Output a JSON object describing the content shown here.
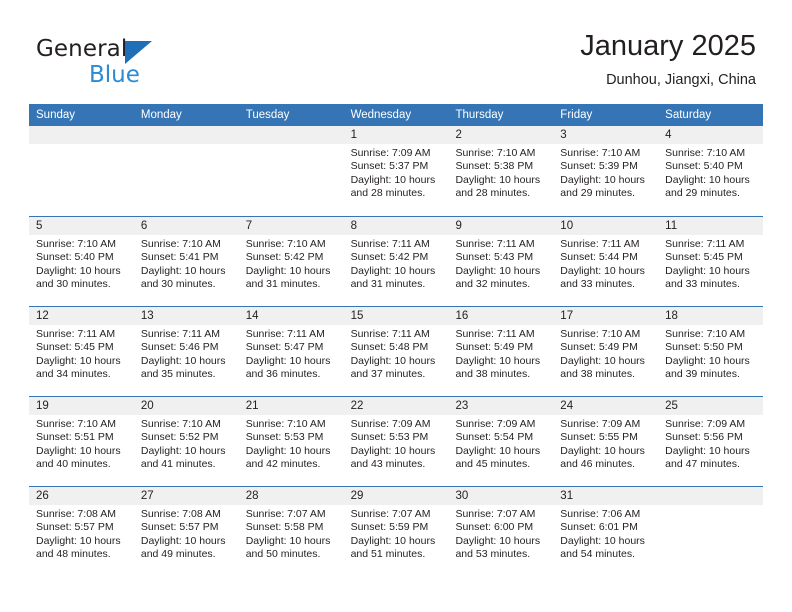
{
  "brand": {
    "name_part1": "General",
    "name_part2": "Blue",
    "triangle_color": "#1e6fb8",
    "blue_color": "#2b8bd4"
  },
  "header": {
    "title": "January 2025",
    "subtitle": "Dunhou, Jiangxi, China"
  },
  "colors": {
    "header_band": "#3575b5",
    "day_number_band": "#f0f0f0",
    "text": "#231f20"
  },
  "weekdays": [
    "Sunday",
    "Monday",
    "Tuesday",
    "Wednesday",
    "Thursday",
    "Friday",
    "Saturday"
  ],
  "labels": {
    "sunrise": "Sunrise:",
    "sunset": "Sunset:",
    "daylight": "Daylight:"
  },
  "weeks": [
    [
      {
        "day": "",
        "empty": true
      },
      {
        "day": "",
        "empty": true
      },
      {
        "day": "",
        "empty": true
      },
      {
        "day": "1",
        "sunrise": "Sunrise: 7:09 AM",
        "sunset": "Sunset: 5:37 PM",
        "daylight_l1": "Daylight: 10 hours",
        "daylight_l2": "and 28 minutes."
      },
      {
        "day": "2",
        "sunrise": "Sunrise: 7:10 AM",
        "sunset": "Sunset: 5:38 PM",
        "daylight_l1": "Daylight: 10 hours",
        "daylight_l2": "and 28 minutes."
      },
      {
        "day": "3",
        "sunrise": "Sunrise: 7:10 AM",
        "sunset": "Sunset: 5:39 PM",
        "daylight_l1": "Daylight: 10 hours",
        "daylight_l2": "and 29 minutes."
      },
      {
        "day": "4",
        "sunrise": "Sunrise: 7:10 AM",
        "sunset": "Sunset: 5:40 PM",
        "daylight_l1": "Daylight: 10 hours",
        "daylight_l2": "and 29 minutes."
      }
    ],
    [
      {
        "day": "5",
        "sunrise": "Sunrise: 7:10 AM",
        "sunset": "Sunset: 5:40 PM",
        "daylight_l1": "Daylight: 10 hours",
        "daylight_l2": "and 30 minutes."
      },
      {
        "day": "6",
        "sunrise": "Sunrise: 7:10 AM",
        "sunset": "Sunset: 5:41 PM",
        "daylight_l1": "Daylight: 10 hours",
        "daylight_l2": "and 30 minutes."
      },
      {
        "day": "7",
        "sunrise": "Sunrise: 7:10 AM",
        "sunset": "Sunset: 5:42 PM",
        "daylight_l1": "Daylight: 10 hours",
        "daylight_l2": "and 31 minutes."
      },
      {
        "day": "8",
        "sunrise": "Sunrise: 7:11 AM",
        "sunset": "Sunset: 5:42 PM",
        "daylight_l1": "Daylight: 10 hours",
        "daylight_l2": "and 31 minutes."
      },
      {
        "day": "9",
        "sunrise": "Sunrise: 7:11 AM",
        "sunset": "Sunset: 5:43 PM",
        "daylight_l1": "Daylight: 10 hours",
        "daylight_l2": "and 32 minutes."
      },
      {
        "day": "10",
        "sunrise": "Sunrise: 7:11 AM",
        "sunset": "Sunset: 5:44 PM",
        "daylight_l1": "Daylight: 10 hours",
        "daylight_l2": "and 33 minutes."
      },
      {
        "day": "11",
        "sunrise": "Sunrise: 7:11 AM",
        "sunset": "Sunset: 5:45 PM",
        "daylight_l1": "Daylight: 10 hours",
        "daylight_l2": "and 33 minutes."
      }
    ],
    [
      {
        "day": "12",
        "sunrise": "Sunrise: 7:11 AM",
        "sunset": "Sunset: 5:45 PM",
        "daylight_l1": "Daylight: 10 hours",
        "daylight_l2": "and 34 minutes."
      },
      {
        "day": "13",
        "sunrise": "Sunrise: 7:11 AM",
        "sunset": "Sunset: 5:46 PM",
        "daylight_l1": "Daylight: 10 hours",
        "daylight_l2": "and 35 minutes."
      },
      {
        "day": "14",
        "sunrise": "Sunrise: 7:11 AM",
        "sunset": "Sunset: 5:47 PM",
        "daylight_l1": "Daylight: 10 hours",
        "daylight_l2": "and 36 minutes."
      },
      {
        "day": "15",
        "sunrise": "Sunrise: 7:11 AM",
        "sunset": "Sunset: 5:48 PM",
        "daylight_l1": "Daylight: 10 hours",
        "daylight_l2": "and 37 minutes."
      },
      {
        "day": "16",
        "sunrise": "Sunrise: 7:11 AM",
        "sunset": "Sunset: 5:49 PM",
        "daylight_l1": "Daylight: 10 hours",
        "daylight_l2": "and 38 minutes."
      },
      {
        "day": "17",
        "sunrise": "Sunrise: 7:10 AM",
        "sunset": "Sunset: 5:49 PM",
        "daylight_l1": "Daylight: 10 hours",
        "daylight_l2": "and 38 minutes."
      },
      {
        "day": "18",
        "sunrise": "Sunrise: 7:10 AM",
        "sunset": "Sunset: 5:50 PM",
        "daylight_l1": "Daylight: 10 hours",
        "daylight_l2": "and 39 minutes."
      }
    ],
    [
      {
        "day": "19",
        "sunrise": "Sunrise: 7:10 AM",
        "sunset": "Sunset: 5:51 PM",
        "daylight_l1": "Daylight: 10 hours",
        "daylight_l2": "and 40 minutes."
      },
      {
        "day": "20",
        "sunrise": "Sunrise: 7:10 AM",
        "sunset": "Sunset: 5:52 PM",
        "daylight_l1": "Daylight: 10 hours",
        "daylight_l2": "and 41 minutes."
      },
      {
        "day": "21",
        "sunrise": "Sunrise: 7:10 AM",
        "sunset": "Sunset: 5:53 PM",
        "daylight_l1": "Daylight: 10 hours",
        "daylight_l2": "and 42 minutes."
      },
      {
        "day": "22",
        "sunrise": "Sunrise: 7:09 AM",
        "sunset": "Sunset: 5:53 PM",
        "daylight_l1": "Daylight: 10 hours",
        "daylight_l2": "and 43 minutes."
      },
      {
        "day": "23",
        "sunrise": "Sunrise: 7:09 AM",
        "sunset": "Sunset: 5:54 PM",
        "daylight_l1": "Daylight: 10 hours",
        "daylight_l2": "and 45 minutes."
      },
      {
        "day": "24",
        "sunrise": "Sunrise: 7:09 AM",
        "sunset": "Sunset: 5:55 PM",
        "daylight_l1": "Daylight: 10 hours",
        "daylight_l2": "and 46 minutes."
      },
      {
        "day": "25",
        "sunrise": "Sunrise: 7:09 AM",
        "sunset": "Sunset: 5:56 PM",
        "daylight_l1": "Daylight: 10 hours",
        "daylight_l2": "and 47 minutes."
      }
    ],
    [
      {
        "day": "26",
        "sunrise": "Sunrise: 7:08 AM",
        "sunset": "Sunset: 5:57 PM",
        "daylight_l1": "Daylight: 10 hours",
        "daylight_l2": "and 48 minutes."
      },
      {
        "day": "27",
        "sunrise": "Sunrise: 7:08 AM",
        "sunset": "Sunset: 5:57 PM",
        "daylight_l1": "Daylight: 10 hours",
        "daylight_l2": "and 49 minutes."
      },
      {
        "day": "28",
        "sunrise": "Sunrise: 7:07 AM",
        "sunset": "Sunset: 5:58 PM",
        "daylight_l1": "Daylight: 10 hours",
        "daylight_l2": "and 50 minutes."
      },
      {
        "day": "29",
        "sunrise": "Sunrise: 7:07 AM",
        "sunset": "Sunset: 5:59 PM",
        "daylight_l1": "Daylight: 10 hours",
        "daylight_l2": "and 51 minutes."
      },
      {
        "day": "30",
        "sunrise": "Sunrise: 7:07 AM",
        "sunset": "Sunset: 6:00 PM",
        "daylight_l1": "Daylight: 10 hours",
        "daylight_l2": "and 53 minutes."
      },
      {
        "day": "31",
        "sunrise": "Sunrise: 7:06 AM",
        "sunset": "Sunset: 6:01 PM",
        "daylight_l1": "Daylight: 10 hours",
        "daylight_l2": "and 54 minutes."
      },
      {
        "day": "",
        "empty": true
      }
    ]
  ]
}
